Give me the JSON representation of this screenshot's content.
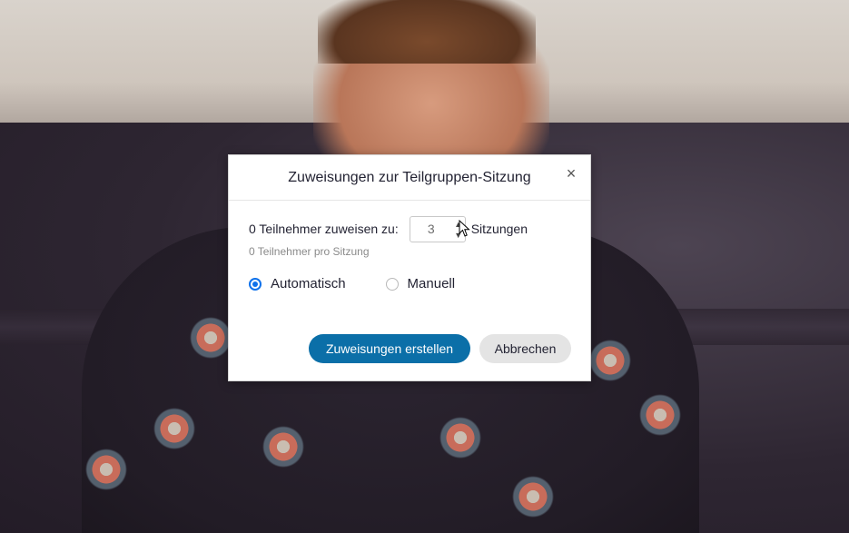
{
  "dialog": {
    "title": "Zuweisungen zur Teilgruppen-Sitzung",
    "close_icon": "×",
    "assign_label": "0 Teilnehmer zuweisen zu:",
    "session_count": "3",
    "sessions_label": "Sitzungen",
    "per_session_text": "0 Teilnehmer pro Sitzung",
    "radio_options": [
      {
        "label": "Automatisch",
        "selected": true
      },
      {
        "label": "Manuell",
        "selected": false
      }
    ],
    "create_button": "Zuweisungen erstellen",
    "cancel_button": "Abbrechen"
  },
  "colors": {
    "primary_button": "#0b6fa8",
    "radio_selected": "#0e71eb",
    "secondary_button": "#e4e4e4"
  }
}
